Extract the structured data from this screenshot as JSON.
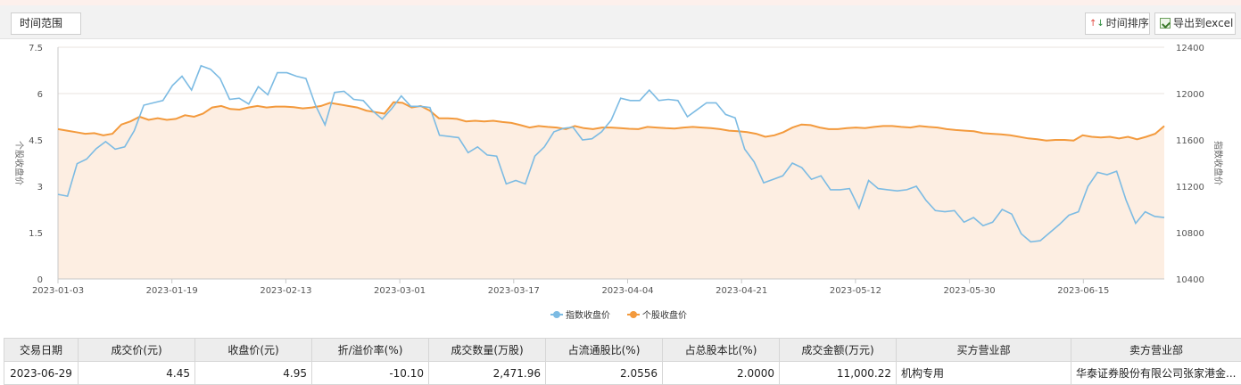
{
  "toolbar": {
    "range_label": "时间范围",
    "sort_label": "时间排序",
    "export_label": "导出到excel"
  },
  "colors": {
    "index_line": "#7cbbe3",
    "stock_line": "#f39a3d",
    "stock_area": "#fdeee2",
    "grid": "#e9e3df"
  },
  "chart_data": {
    "type": "line",
    "left_axis": {
      "label": "个股收盘价",
      "range": [
        0,
        7.5
      ],
      "ticks": [
        "0",
        "1.5",
        "3",
        "4.5",
        "6",
        "7.5"
      ]
    },
    "right_axis": {
      "label": "指数收盘价",
      "range": [
        10400,
        12400
      ],
      "ticks": [
        "10400",
        "10800",
        "11200",
        "11600",
        "12000",
        "12400"
      ]
    },
    "x_ticks": [
      "2023-01-03",
      "2023-01-19",
      "2023-02-13",
      "2023-03-01",
      "2023-03-17",
      "2023-04-04",
      "2023-04-21",
      "2023-05-12",
      "2023-05-30",
      "2023-06-15"
    ],
    "legend": [
      "指数收盘价",
      "个股收盘价"
    ],
    "legend_position": "bottom",
    "series": [
      {
        "name": "指数收盘价",
        "axis": "right",
        "values": [
          11130,
          11115,
          11395,
          11435,
          11525,
          11585,
          11520,
          11540,
          11680,
          11900,
          11920,
          11940,
          12070,
          12150,
          12030,
          12240,
          12210,
          12130,
          11950,
          11960,
          11910,
          12060,
          11990,
          12180,
          12180,
          12150,
          12130,
          11900,
          11730,
          12010,
          12020,
          11950,
          11940,
          11850,
          11780,
          11870,
          11980,
          11890,
          11890,
          11880,
          11640,
          11630,
          11620,
          11490,
          11540,
          11470,
          11460,
          11220,
          11250,
          11220,
          11460,
          11540,
          11670,
          11700,
          11710,
          11600,
          11610,
          11670,
          11770,
          11960,
          11940,
          11940,
          12030,
          11940,
          11950,
          11940,
          11800,
          11860,
          11920,
          11920,
          11820,
          11790,
          11520,
          11410,
          11230,
          11260,
          11290,
          11400,
          11360,
          11260,
          11290,
          11170,
          11170,
          11180,
          11010,
          11250,
          11180,
          11170,
          11160,
          11170,
          11200,
          11080,
          10990,
          10980,
          10990,
          10890,
          10930,
          10860,
          10890,
          11000,
          10960,
          10790,
          10720,
          10730,
          10800,
          10870,
          10950,
          10980,
          11200,
          11320,
          11300,
          11330,
          11080,
          10880,
          10980,
          10940,
          10930
        ],
        "data_labels": []
      },
      {
        "name": "个股收盘价",
        "axis": "left",
        "values": [
          4.85,
          4.8,
          4.75,
          4.7,
          4.72,
          4.65,
          4.7,
          5.0,
          5.1,
          5.25,
          5.15,
          5.2,
          5.15,
          5.18,
          5.3,
          5.25,
          5.35,
          5.55,
          5.6,
          5.5,
          5.48,
          5.55,
          5.6,
          5.55,
          5.58,
          5.58,
          5.56,
          5.52,
          5.55,
          5.6,
          5.7,
          5.65,
          5.6,
          5.55,
          5.45,
          5.4,
          5.35,
          5.72,
          5.7,
          5.55,
          5.6,
          5.45,
          5.2,
          5.2,
          5.18,
          5.1,
          5.12,
          5.1,
          5.12,
          5.08,
          5.05,
          4.98,
          4.9,
          4.95,
          4.92,
          4.9,
          4.85,
          4.95,
          4.88,
          4.85,
          4.9,
          4.9,
          4.88,
          4.86,
          4.85,
          4.92,
          4.9,
          4.88,
          4.87,
          4.9,
          4.92,
          4.9,
          4.88,
          4.85,
          4.8,
          4.78,
          4.75,
          4.7,
          4.6,
          4.65,
          4.75,
          4.9,
          5.0,
          4.98,
          4.9,
          4.85,
          4.85,
          4.88,
          4.9,
          4.88,
          4.92,
          4.95,
          4.95,
          4.92,
          4.9,
          4.95,
          4.92,
          4.9,
          4.85,
          4.82,
          4.8,
          4.78,
          4.72,
          4.7,
          4.68,
          4.65,
          4.6,
          4.55,
          4.52,
          4.48,
          4.5,
          4.5,
          4.48,
          4.65,
          4.6,
          4.58,
          4.6,
          4.55,
          4.6,
          4.52,
          4.6,
          4.7,
          4.95
        ],
        "data_labels": []
      }
    ]
  },
  "table": {
    "headers": [
      "交易日期",
      "成交价(元)",
      "收盘价(元)",
      "折/溢价率(%)",
      "成交数量(万股)",
      "占流通股比(%)",
      "占总股本比(%)",
      "成交金额(万元)",
      "买方营业部",
      "卖方营业部"
    ],
    "rows": [
      [
        "2023-06-29",
        "4.45",
        "4.95",
        "-10.10",
        "2,471.96",
        "2.0556",
        "2.0000",
        "11,000.22",
        "机构专用",
        "华泰证券股份有限公司张家港金..."
      ]
    ]
  }
}
